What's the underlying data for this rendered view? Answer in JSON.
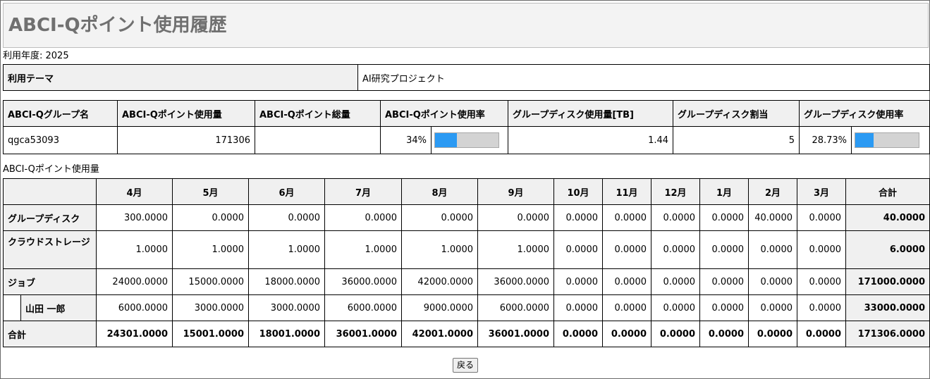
{
  "page": {
    "title": "ABCI-Qポイント使用履歴",
    "year_label": "利用年度: 2025"
  },
  "theme": {
    "label": "利用テーマ",
    "value": "AI研究プロジェクト"
  },
  "group": {
    "headers": [
      "ABCI-Qグループ名",
      "ABCI-Qポイント使用量",
      "ABCI-Qポイント総量",
      "ABCI-Qポイント使用率",
      "グループディスク使用量[TB]",
      "グループディスク割当",
      "グループディスク使用率"
    ],
    "name": "qgca53093",
    "point_used": "171306",
    "point_total": "",
    "point_rate": "34%",
    "point_rate_fraction": 0.34,
    "disk_used": "1.44",
    "disk_quota": "5",
    "disk_rate": "28.73%",
    "disk_rate_fraction": 0.2873,
    "bar_fill_color": "#2b9af3",
    "bar_track_color": "#d3d3d3"
  },
  "usage": {
    "caption": "ABCI-Qポイント使用量",
    "months": [
      "4月",
      "5月",
      "6月",
      "7月",
      "8月",
      "9月",
      "10月",
      "11月",
      "12月",
      "1月",
      "2月",
      "3月"
    ],
    "total_header": "合計",
    "rows": {
      "disk": {
        "label": "グループディスク",
        "values": [
          "300.0000",
          "0.0000",
          "0.0000",
          "0.0000",
          "0.0000",
          "0.0000",
          "0.0000",
          "0.0000",
          "0.0000",
          "0.0000",
          "40.0000",
          "0.0000"
        ],
        "total": "40.0000"
      },
      "cloud": {
        "label": "クラウドストレージ",
        "values": [
          "1.0000",
          "1.0000",
          "1.0000",
          "1.0000",
          "1.0000",
          "1.0000",
          "0.0000",
          "0.0000",
          "0.0000",
          "0.0000",
          "0.0000",
          "0.0000"
        ],
        "total": "6.0000"
      },
      "job": {
        "label": "ジョブ",
        "values": [
          "24000.0000",
          "15000.0000",
          "18000.0000",
          "36000.0000",
          "42000.0000",
          "36000.0000",
          "0.0000",
          "0.0000",
          "0.0000",
          "0.0000",
          "0.0000",
          "0.0000"
        ],
        "total": "171000.0000"
      },
      "user": {
        "label": "山田 一郎",
        "values": [
          "6000.0000",
          "3000.0000",
          "3000.0000",
          "6000.0000",
          "9000.0000",
          "6000.0000",
          "0.0000",
          "0.0000",
          "0.0000",
          "0.0000",
          "0.0000",
          "0.0000"
        ],
        "total": "33000.0000"
      },
      "sum": {
        "label": "合計",
        "values": [
          "24301.0000",
          "15001.0000",
          "18001.0000",
          "36001.0000",
          "42001.0000",
          "36001.0000",
          "0.0000",
          "0.0000",
          "0.0000",
          "0.0000",
          "0.0000",
          "0.0000"
        ],
        "total": "171306.0000"
      }
    }
  },
  "back_button": "戻る"
}
